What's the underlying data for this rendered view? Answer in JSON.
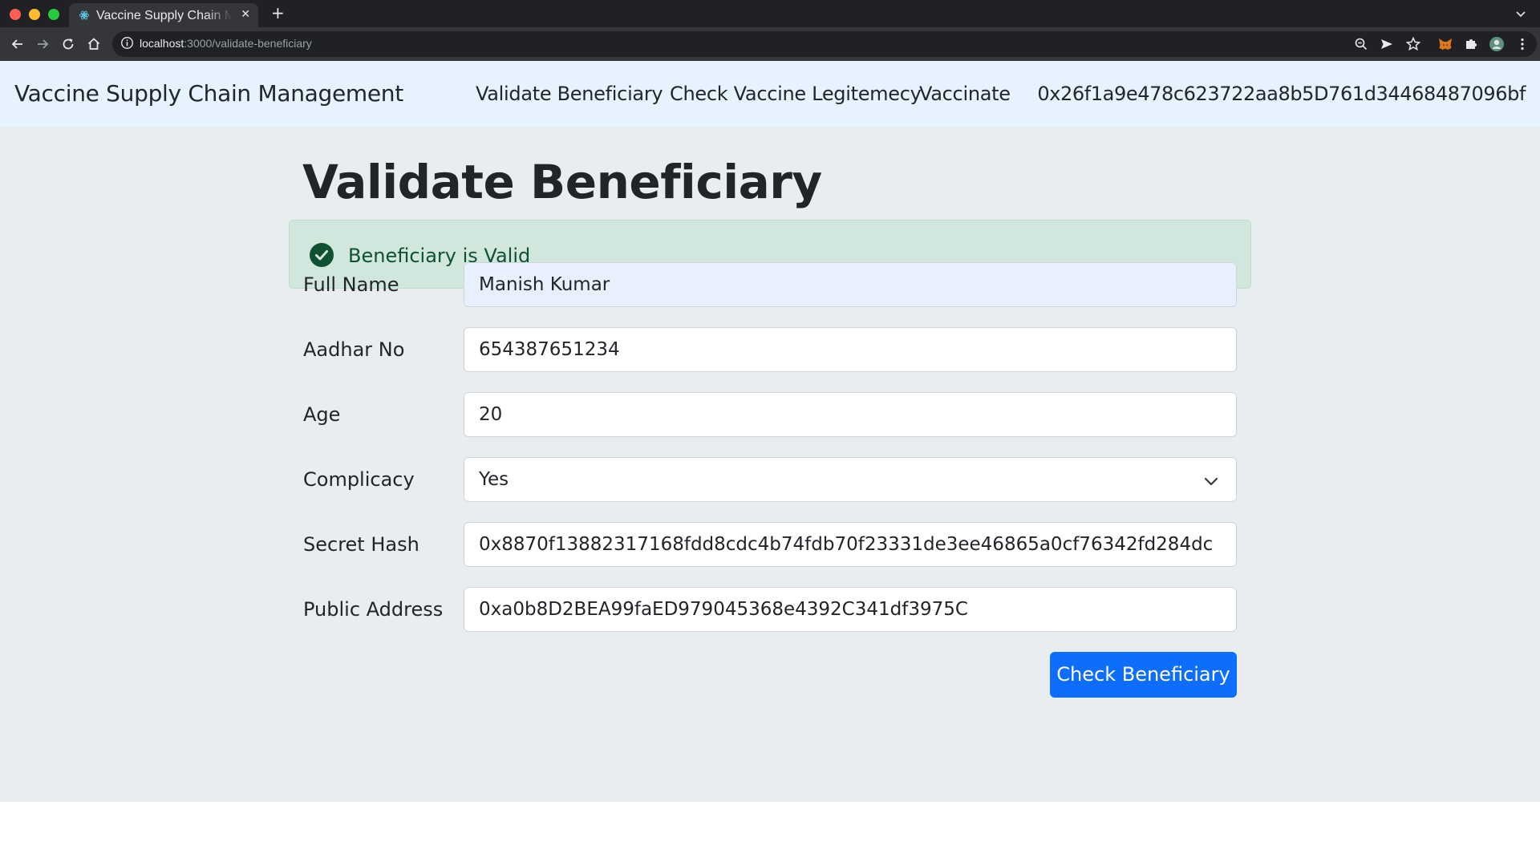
{
  "browser": {
    "tab_title": "Vaccine Supply Chain Management",
    "tab_close_glyph": "✕",
    "new_tab_glyph": "+",
    "url_host": "localhost",
    "url_path": ":3000/validate-beneficiary",
    "icons": [
      "back-arrow-icon",
      "forward-arrow-icon",
      "reload-icon",
      "home-icon",
      "info-icon",
      "zoom-icon",
      "send-icon",
      "star-icon",
      "metamask-fox-icon",
      "puzzle-piece-icon",
      "profile-avatar-icon",
      "kebab-menu-icon"
    ]
  },
  "navbar": {
    "brand": "Vaccine Supply Chain Management",
    "links": [
      "Validate Beneficiary",
      "Check Vaccine Legitemecy",
      "Vaccinate"
    ],
    "account": "0x26f1a9e478c623722aa8b5D761d34468487096bf"
  },
  "main": {
    "title": "Validate Beneficiary",
    "alert": {
      "text": "Beneficiary is Valid",
      "icon": "check-circle-icon",
      "color": "#0f5132"
    },
    "fields": {
      "full_name": {
        "label": "Full Name",
        "value": "Manish Kumar"
      },
      "aadhar": {
        "label": "Aadhar No",
        "value": "654387651234"
      },
      "age": {
        "label": "Age",
        "value": "20"
      },
      "complicacy": {
        "label": "Complicacy",
        "value": "Yes"
      },
      "secret_hash": {
        "label": "Secret Hash",
        "value": "0x8870f13882317168fdd8cdc4b74fdb70f23331de3ee46865a0cf76342fd284dc"
      },
      "public_address": {
        "label": "Public Address",
        "value": "0xa0b8D2BEA99faED979045368e4392C341df3975C"
      }
    },
    "submit_label": "Check Beneficiary"
  },
  "colors": {
    "navbar_bg": "#e6f2fd",
    "page_bg": "#e8eef0",
    "primary": "#0d6efd",
    "success_bg": "#d1e7dd"
  }
}
